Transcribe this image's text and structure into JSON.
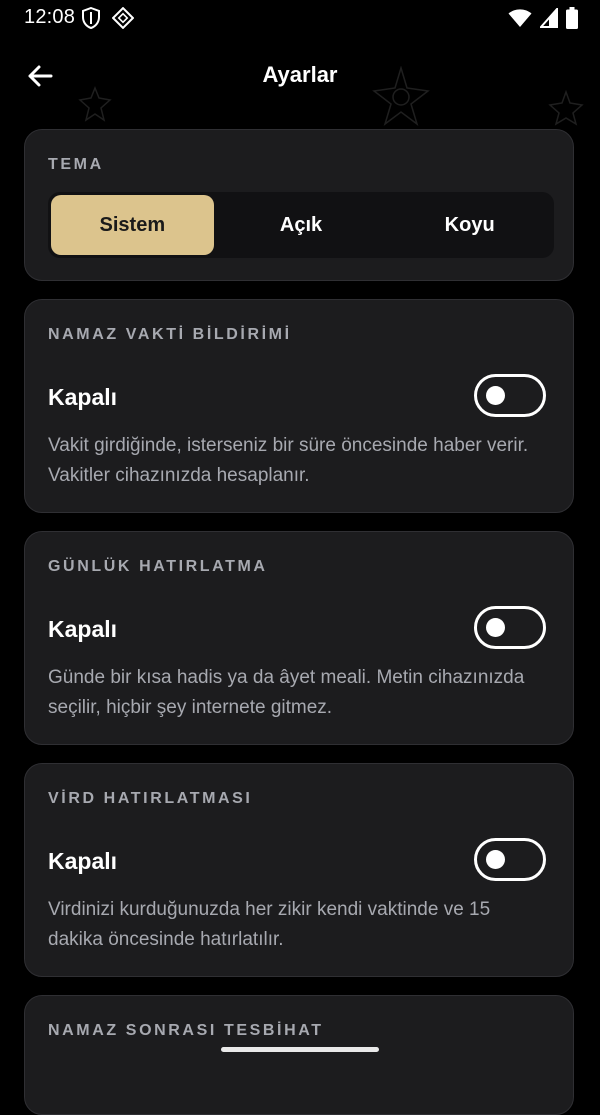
{
  "status": {
    "time": "12:08"
  },
  "appbar": {
    "title": "Ayarlar"
  },
  "theme": {
    "label": "TEMA",
    "options": [
      "Sistem",
      "Açık",
      "Koyu"
    ],
    "selected": "Sistem",
    "accent": "#dcc48d"
  },
  "prayer_notification": {
    "label": "NAMAZ VAKTİ BİLDİRİMİ",
    "state": "Kapalı",
    "enabled": false,
    "description": "Vakit girdiğinde, isterseniz bir süre öncesinde haber verir. Vakitler cihazınızda hesaplanır."
  },
  "daily_reminder": {
    "label": "GÜNLÜK HATIRLATMA",
    "state": "Kapalı",
    "enabled": false,
    "description": "Günde bir kısa hadis ya da âyet meali. Metin cihazınızda seçilir, hiçbir şey internete gitmez."
  },
  "wird_reminder": {
    "label": "VİRD HATIRLATMASI",
    "state": "Kapalı",
    "enabled": false,
    "description": "Virdinizi kurduğunuzda her zikir kendi vaktinde ve 15 dakika öncesinde hatırlatılır."
  },
  "tesbihat": {
    "label": "NAMAZ SONRASI TESBİHAT"
  },
  "icons": {
    "back": "arrow-left-icon",
    "wifi": "wifi-icon",
    "signal": "signal-icon",
    "battery": "battery-icon",
    "shield": "shield-icon",
    "app": "diamond-icon"
  }
}
